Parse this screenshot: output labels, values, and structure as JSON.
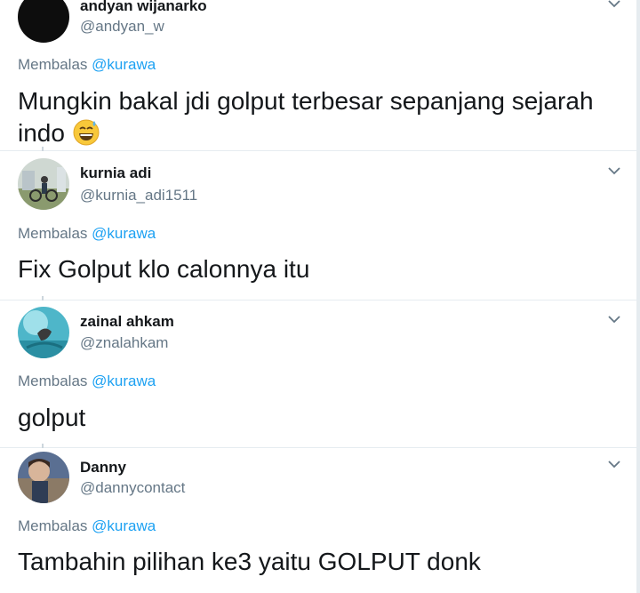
{
  "reply_prefix": "Membalas",
  "mention": "@kurawa",
  "tweets": [
    {
      "name": "andyan wijanarko",
      "handle": "@andyan_w",
      "text_line1": "Mungkin bakal jdi golput terbesar sepanjang sejarah",
      "text_line2": "indo",
      "emoji": "grinning-face-with-sweat-emoji"
    },
    {
      "name": "kurnia adi",
      "handle": "@kurnia_adi1511",
      "text": "Fix Golput klo calonnya itu"
    },
    {
      "name": "zainal ahkam",
      "handle": "@znalahkam",
      "text": "golput"
    },
    {
      "name": "Danny",
      "handle": "@dannycontact",
      "text": "Tambahin pilihan ke3 yaitu GOLPUT donk"
    }
  ],
  "colors": {
    "text": "#14171a",
    "secondary": "#657786",
    "link": "#1da1f2",
    "divider": "#e6ecf0"
  },
  "icons": {
    "menu": "chevron-down-icon"
  }
}
